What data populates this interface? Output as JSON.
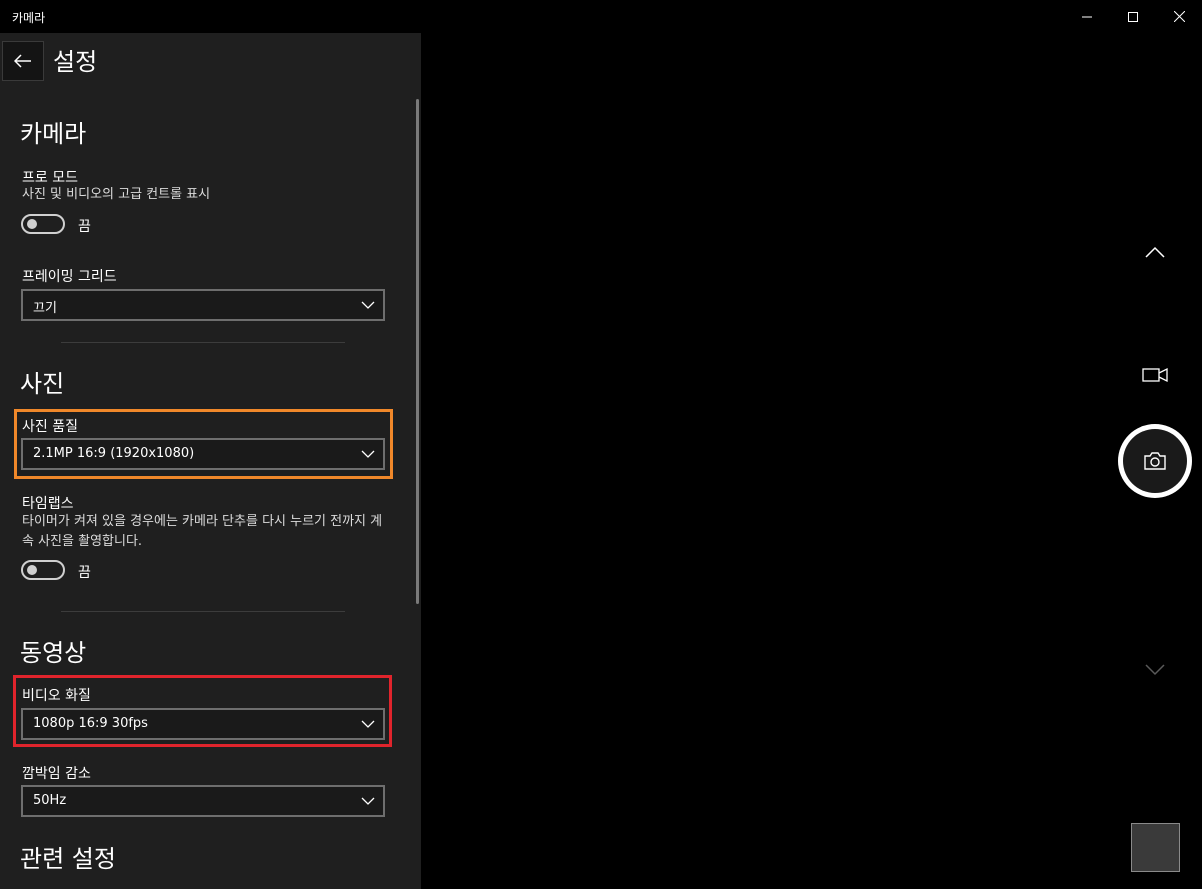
{
  "window": {
    "title": "카메라",
    "controls": [
      "minimize-icon",
      "maximize-icon",
      "close-icon"
    ]
  },
  "settings": {
    "header": {
      "back_icon": "arrow-left-icon",
      "title": "설정"
    },
    "camera_section": {
      "heading": "카메라",
      "pro_mode": {
        "label": "프로 모드",
        "description": "사진 및 비디오의 고급 컨트롤 표시",
        "state": "끔"
      },
      "framing_grid": {
        "label": "프레이밍 그리드",
        "selected": "끄기"
      }
    },
    "photo_section": {
      "heading": "사진",
      "photo_quality": {
        "label": "사진 품질",
        "selected": "2.1MP 16:9 (1920x1080)"
      },
      "time_lapse": {
        "label": "타임랩스",
        "description": "타이머가 켜져 있을 경우에는 카메라 단추를 다시 누르기 전까지 계속 사진을 촬영합니다.",
        "state": "끔"
      }
    },
    "video_section": {
      "heading": "동영상",
      "video_quality": {
        "label": "비디오 화질",
        "selected": "1080p 16:9 30fps"
      },
      "flicker_reduction": {
        "label": "깜박임 감소",
        "selected": "50Hz"
      }
    },
    "related_section": {
      "heading": "관련 설정"
    }
  },
  "camera": {
    "icons": [
      "chevron-up-icon",
      "video-camera-icon",
      "camera-icon",
      "chevron-down-icon"
    ]
  },
  "colors": {
    "panel_bg": "#1f1f1f",
    "highlight_photo_quality": "#f0882a",
    "highlight_video_quality": "#e0242c"
  }
}
